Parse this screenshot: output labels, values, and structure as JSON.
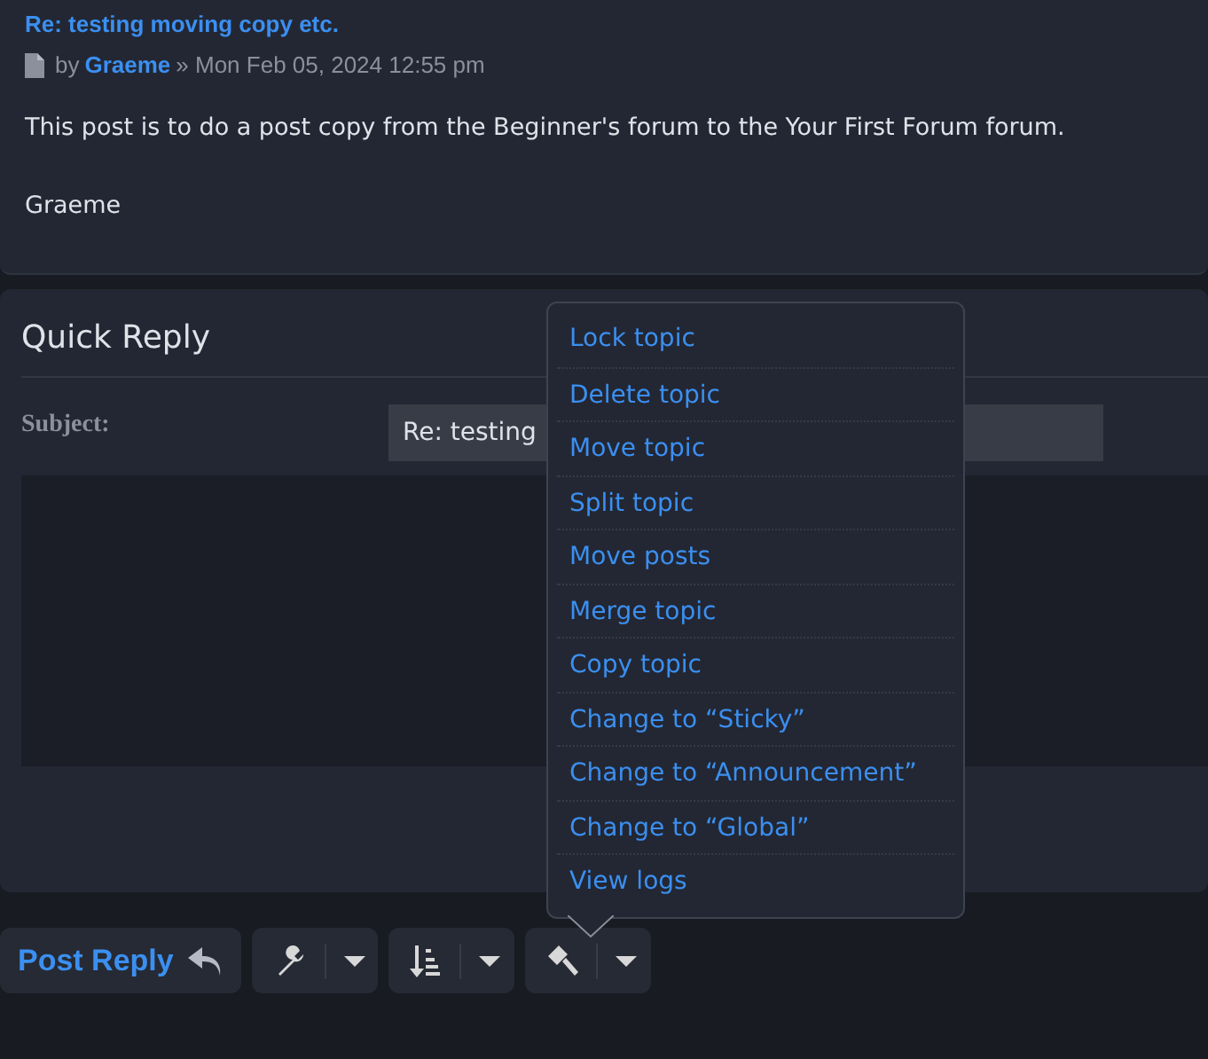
{
  "post": {
    "title": "Re: testing moving copy etc.",
    "by": "by",
    "author": "Graeme",
    "date": "» Mon Feb 05, 2024 12:55 pm",
    "body": [
      "This post is to do a post copy from the Beginner's forum to the Your First Forum forum.",
      "Graeme"
    ]
  },
  "quick_reply": {
    "title": "Quick Reply",
    "subject_label": "Subject:",
    "subject_value": "Re: testing"
  },
  "buttons": {
    "post_reply": "Post Reply"
  },
  "moderator_menu": {
    "items": [
      "Lock topic",
      "Delete topic",
      "Move topic",
      "Split topic",
      "Move posts",
      "Merge topic",
      "Copy topic",
      "Change to “Sticky”",
      "Change to “Announcement”",
      "Change to “Global”",
      "View logs"
    ]
  }
}
